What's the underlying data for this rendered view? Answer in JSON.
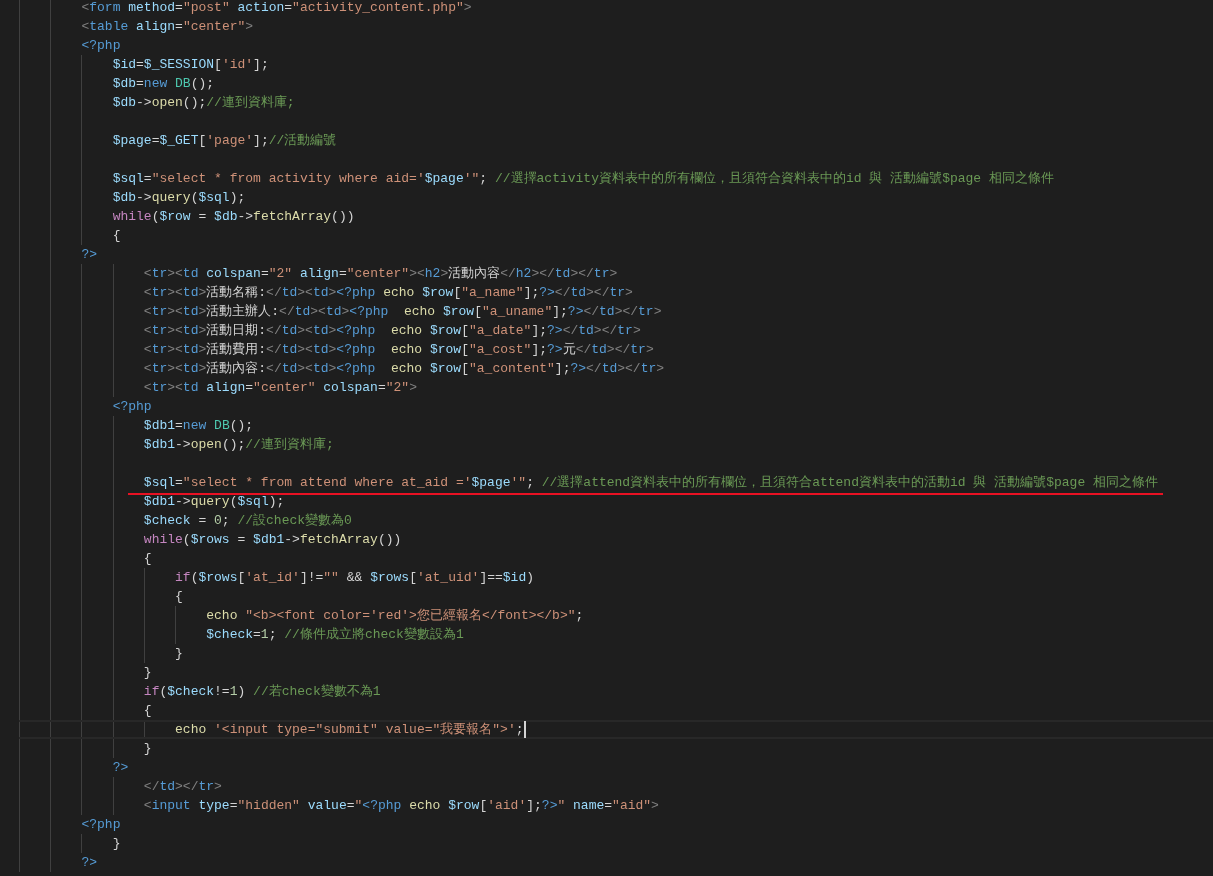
{
  "editor": {
    "lines": [
      {
        "kind": "code",
        "underlined": false,
        "current": false,
        "tokens": [
          {
            "kind": "bracket",
            "text": "        <"
          },
          {
            "kind": "tag",
            "text": "form"
          },
          {
            "kind": "attr",
            "text": " method"
          },
          {
            "kind": "plain",
            "text": "="
          },
          {
            "kind": "string",
            "text": "\"post\""
          },
          {
            "kind": "attr",
            "text": " action"
          },
          {
            "kind": "plain",
            "text": "="
          },
          {
            "kind": "string",
            "text": "\"activity_content.php\""
          },
          {
            "kind": "bracket",
            "text": ">"
          }
        ]
      },
      {
        "kind": "code",
        "underlined": false,
        "current": false,
        "tokens": [
          {
            "kind": "bracket",
            "text": "        <"
          },
          {
            "kind": "tag",
            "text": "table"
          },
          {
            "kind": "attr",
            "text": " align"
          },
          {
            "kind": "plain",
            "text": "="
          },
          {
            "kind": "string",
            "text": "\"center\""
          },
          {
            "kind": "bracket",
            "text": ">"
          }
        ]
      },
      {
        "kind": "code",
        "underlined": false,
        "current": false,
        "tokens": [
          {
            "kind": "tag",
            "text": "        <?php"
          }
        ]
      },
      {
        "kind": "code",
        "underlined": false,
        "current": false,
        "tokens": [
          {
            "kind": "var",
            "text": "            $id"
          },
          {
            "kind": "plain",
            "text": "="
          },
          {
            "kind": "var",
            "text": "$_SESSION"
          },
          {
            "kind": "plain",
            "text": "["
          },
          {
            "kind": "string",
            "text": "'id'"
          },
          {
            "kind": "plain",
            "text": "];"
          }
        ]
      },
      {
        "kind": "code",
        "underlined": false,
        "current": false,
        "tokens": [
          {
            "kind": "var",
            "text": "            $db"
          },
          {
            "kind": "plain",
            "text": "="
          },
          {
            "kind": "tag",
            "text": "new "
          },
          {
            "kind": "class",
            "text": "DB"
          },
          {
            "kind": "plain",
            "text": "();"
          }
        ]
      },
      {
        "kind": "code",
        "underlined": false,
        "current": false,
        "tokens": [
          {
            "kind": "var",
            "text": "            $db"
          },
          {
            "kind": "plain",
            "text": "->"
          },
          {
            "kind": "func",
            "text": "open"
          },
          {
            "kind": "plain",
            "text": "();"
          },
          {
            "kind": "comment",
            "text": "//連到資料庫;"
          }
        ]
      },
      {
        "kind": "blank"
      },
      {
        "kind": "code",
        "underlined": false,
        "current": false,
        "tokens": [
          {
            "kind": "var",
            "text": "            $page"
          },
          {
            "kind": "plain",
            "text": "="
          },
          {
            "kind": "var",
            "text": "$_GET"
          },
          {
            "kind": "plain",
            "text": "["
          },
          {
            "kind": "string",
            "text": "'page'"
          },
          {
            "kind": "plain",
            "text": "];"
          },
          {
            "kind": "comment",
            "text": "//活動編號"
          }
        ]
      },
      {
        "kind": "blank"
      },
      {
        "kind": "code",
        "underlined": false,
        "current": false,
        "tokens": [
          {
            "kind": "var",
            "text": "            $sql"
          },
          {
            "kind": "plain",
            "text": "="
          },
          {
            "kind": "string",
            "text": "\"select * from activity where aid='"
          },
          {
            "kind": "var",
            "text": "$page"
          },
          {
            "kind": "string",
            "text": "'\""
          },
          {
            "kind": "plain",
            "text": "; "
          },
          {
            "kind": "comment",
            "text": "//選擇activity資料表中的所有欄位，且須符合資料表中的id 與 活動編號$page 相同之條件"
          }
        ]
      },
      {
        "kind": "code",
        "underlined": false,
        "current": false,
        "tokens": [
          {
            "kind": "var",
            "text": "            $db"
          },
          {
            "kind": "plain",
            "text": "->"
          },
          {
            "kind": "func",
            "text": "query"
          },
          {
            "kind": "plain",
            "text": "("
          },
          {
            "kind": "var",
            "text": "$sql"
          },
          {
            "kind": "plain",
            "text": ");"
          }
        ]
      },
      {
        "kind": "code",
        "underlined": false,
        "current": false,
        "tokens": [
          {
            "kind": "keyword",
            "text": "            while"
          },
          {
            "kind": "plain",
            "text": "("
          },
          {
            "kind": "var",
            "text": "$row"
          },
          {
            "kind": "plain",
            "text": " = "
          },
          {
            "kind": "var",
            "text": "$db"
          },
          {
            "kind": "plain",
            "text": "->"
          },
          {
            "kind": "func",
            "text": "fetchArray"
          },
          {
            "kind": "plain",
            "text": "())"
          }
        ]
      },
      {
        "kind": "code",
        "underlined": false,
        "current": false,
        "tokens": [
          {
            "kind": "plain",
            "text": "            {"
          }
        ]
      },
      {
        "kind": "code",
        "underlined": false,
        "current": false,
        "tokens": [
          {
            "kind": "tag",
            "text": "        ?>"
          }
        ]
      },
      {
        "kind": "code",
        "underlined": false,
        "current": false,
        "tokens": [
          {
            "kind": "bracket",
            "text": "                <"
          },
          {
            "kind": "tag",
            "text": "tr"
          },
          {
            "kind": "bracket",
            "text": "><"
          },
          {
            "kind": "tag",
            "text": "td"
          },
          {
            "kind": "attr",
            "text": " colspan"
          },
          {
            "kind": "plain",
            "text": "="
          },
          {
            "kind": "string",
            "text": "\"2\""
          },
          {
            "kind": "attr",
            "text": " align"
          },
          {
            "kind": "plain",
            "text": "="
          },
          {
            "kind": "string",
            "text": "\"center\""
          },
          {
            "kind": "bracket",
            "text": "><"
          },
          {
            "kind": "tag",
            "text": "h2"
          },
          {
            "kind": "bracket",
            "text": ">"
          },
          {
            "kind": "plain",
            "text": "活動內容"
          },
          {
            "kind": "bracket",
            "text": "</"
          },
          {
            "kind": "tag",
            "text": "h2"
          },
          {
            "kind": "bracket",
            "text": "></"
          },
          {
            "kind": "tag",
            "text": "td"
          },
          {
            "kind": "bracket",
            "text": "></"
          },
          {
            "kind": "tag",
            "text": "tr"
          },
          {
            "kind": "bracket",
            "text": ">"
          }
        ]
      },
      {
        "kind": "code",
        "underlined": false,
        "current": false,
        "tokens": [
          {
            "kind": "bracket",
            "text": "                <"
          },
          {
            "kind": "tag",
            "text": "tr"
          },
          {
            "kind": "bracket",
            "text": "><"
          },
          {
            "kind": "tag",
            "text": "td"
          },
          {
            "kind": "bracket",
            "text": ">"
          },
          {
            "kind": "plain",
            "text": "活動名稱:"
          },
          {
            "kind": "bracket",
            "text": "</"
          },
          {
            "kind": "tag",
            "text": "td"
          },
          {
            "kind": "bracket",
            "text": "><"
          },
          {
            "kind": "tag",
            "text": "td"
          },
          {
            "kind": "bracket",
            "text": ">"
          },
          {
            "kind": "tag",
            "text": "<?php"
          },
          {
            "kind": "func",
            "text": " echo "
          },
          {
            "kind": "var",
            "text": "$row"
          },
          {
            "kind": "plain",
            "text": "["
          },
          {
            "kind": "string",
            "text": "\"a_name\""
          },
          {
            "kind": "plain",
            "text": "];"
          },
          {
            "kind": "tag",
            "text": "?>"
          },
          {
            "kind": "bracket",
            "text": "</"
          },
          {
            "kind": "tag",
            "text": "td"
          },
          {
            "kind": "bracket",
            "text": "></"
          },
          {
            "kind": "tag",
            "text": "tr"
          },
          {
            "kind": "bracket",
            "text": ">"
          }
        ]
      },
      {
        "kind": "code",
        "underlined": false,
        "current": false,
        "tokens": [
          {
            "kind": "bracket",
            "text": "                <"
          },
          {
            "kind": "tag",
            "text": "tr"
          },
          {
            "kind": "bracket",
            "text": "><"
          },
          {
            "kind": "tag",
            "text": "td"
          },
          {
            "kind": "bracket",
            "text": ">"
          },
          {
            "kind": "plain",
            "text": "活動主辦人:"
          },
          {
            "kind": "bracket",
            "text": "</"
          },
          {
            "kind": "tag",
            "text": "td"
          },
          {
            "kind": "bracket",
            "text": "><"
          },
          {
            "kind": "tag",
            "text": "td"
          },
          {
            "kind": "bracket",
            "text": ">"
          },
          {
            "kind": "tag",
            "text": "<?php"
          },
          {
            "kind": "func",
            "text": "  echo "
          },
          {
            "kind": "var",
            "text": "$row"
          },
          {
            "kind": "plain",
            "text": "["
          },
          {
            "kind": "string",
            "text": "\"a_uname\""
          },
          {
            "kind": "plain",
            "text": "];"
          },
          {
            "kind": "tag",
            "text": "?>"
          },
          {
            "kind": "bracket",
            "text": "</"
          },
          {
            "kind": "tag",
            "text": "td"
          },
          {
            "kind": "bracket",
            "text": "></"
          },
          {
            "kind": "tag",
            "text": "tr"
          },
          {
            "kind": "bracket",
            "text": ">"
          }
        ]
      },
      {
        "kind": "code",
        "underlined": false,
        "current": false,
        "tokens": [
          {
            "kind": "bracket",
            "text": "                <"
          },
          {
            "kind": "tag",
            "text": "tr"
          },
          {
            "kind": "bracket",
            "text": "><"
          },
          {
            "kind": "tag",
            "text": "td"
          },
          {
            "kind": "bracket",
            "text": ">"
          },
          {
            "kind": "plain",
            "text": "活動日期:"
          },
          {
            "kind": "bracket",
            "text": "</"
          },
          {
            "kind": "tag",
            "text": "td"
          },
          {
            "kind": "bracket",
            "text": "><"
          },
          {
            "kind": "tag",
            "text": "td"
          },
          {
            "kind": "bracket",
            "text": ">"
          },
          {
            "kind": "tag",
            "text": "<?php"
          },
          {
            "kind": "func",
            "text": "  echo "
          },
          {
            "kind": "var",
            "text": "$row"
          },
          {
            "kind": "plain",
            "text": "["
          },
          {
            "kind": "string",
            "text": "\"a_date\""
          },
          {
            "kind": "plain",
            "text": "];"
          },
          {
            "kind": "tag",
            "text": "?>"
          },
          {
            "kind": "bracket",
            "text": "</"
          },
          {
            "kind": "tag",
            "text": "td"
          },
          {
            "kind": "bracket",
            "text": "></"
          },
          {
            "kind": "tag",
            "text": "tr"
          },
          {
            "kind": "bracket",
            "text": ">"
          }
        ]
      },
      {
        "kind": "code",
        "underlined": false,
        "current": false,
        "tokens": [
          {
            "kind": "bracket",
            "text": "                <"
          },
          {
            "kind": "tag",
            "text": "tr"
          },
          {
            "kind": "bracket",
            "text": "><"
          },
          {
            "kind": "tag",
            "text": "td"
          },
          {
            "kind": "bracket",
            "text": ">"
          },
          {
            "kind": "plain",
            "text": "活動費用:"
          },
          {
            "kind": "bracket",
            "text": "</"
          },
          {
            "kind": "tag",
            "text": "td"
          },
          {
            "kind": "bracket",
            "text": "><"
          },
          {
            "kind": "tag",
            "text": "td"
          },
          {
            "kind": "bracket",
            "text": ">"
          },
          {
            "kind": "tag",
            "text": "<?php"
          },
          {
            "kind": "func",
            "text": "  echo "
          },
          {
            "kind": "var",
            "text": "$row"
          },
          {
            "kind": "plain",
            "text": "["
          },
          {
            "kind": "string",
            "text": "\"a_cost\""
          },
          {
            "kind": "plain",
            "text": "];"
          },
          {
            "kind": "tag",
            "text": "?>"
          },
          {
            "kind": "plain",
            "text": "元"
          },
          {
            "kind": "bracket",
            "text": "</"
          },
          {
            "kind": "tag",
            "text": "td"
          },
          {
            "kind": "bracket",
            "text": "></"
          },
          {
            "kind": "tag",
            "text": "tr"
          },
          {
            "kind": "bracket",
            "text": ">"
          }
        ]
      },
      {
        "kind": "code",
        "underlined": false,
        "current": false,
        "tokens": [
          {
            "kind": "bracket",
            "text": "                <"
          },
          {
            "kind": "tag",
            "text": "tr"
          },
          {
            "kind": "bracket",
            "text": "><"
          },
          {
            "kind": "tag",
            "text": "td"
          },
          {
            "kind": "bracket",
            "text": ">"
          },
          {
            "kind": "plain",
            "text": "活動內容:"
          },
          {
            "kind": "bracket",
            "text": "</"
          },
          {
            "kind": "tag",
            "text": "td"
          },
          {
            "kind": "bracket",
            "text": "><"
          },
          {
            "kind": "tag",
            "text": "td"
          },
          {
            "kind": "bracket",
            "text": ">"
          },
          {
            "kind": "tag",
            "text": "<?php"
          },
          {
            "kind": "func",
            "text": "  echo "
          },
          {
            "kind": "var",
            "text": "$row"
          },
          {
            "kind": "plain",
            "text": "["
          },
          {
            "kind": "string",
            "text": "\"a_content\""
          },
          {
            "kind": "plain",
            "text": "];"
          },
          {
            "kind": "tag",
            "text": "?>"
          },
          {
            "kind": "bracket",
            "text": "</"
          },
          {
            "kind": "tag",
            "text": "td"
          },
          {
            "kind": "bracket",
            "text": "></"
          },
          {
            "kind": "tag",
            "text": "tr"
          },
          {
            "kind": "bracket",
            "text": ">"
          }
        ]
      },
      {
        "kind": "code",
        "underlined": false,
        "current": false,
        "tokens": [
          {
            "kind": "bracket",
            "text": "                <"
          },
          {
            "kind": "tag",
            "text": "tr"
          },
          {
            "kind": "bracket",
            "text": "><"
          },
          {
            "kind": "tag",
            "text": "td"
          },
          {
            "kind": "attr",
            "text": " align"
          },
          {
            "kind": "plain",
            "text": "="
          },
          {
            "kind": "string",
            "text": "\"center\""
          },
          {
            "kind": "attr",
            "text": " colspan"
          },
          {
            "kind": "plain",
            "text": "="
          },
          {
            "kind": "string",
            "text": "\"2\""
          },
          {
            "kind": "bracket",
            "text": ">"
          }
        ]
      },
      {
        "kind": "code",
        "underlined": false,
        "current": false,
        "tokens": [
          {
            "kind": "tag",
            "text": "            <?php"
          }
        ]
      },
      {
        "kind": "code",
        "underlined": false,
        "current": false,
        "tokens": [
          {
            "kind": "var",
            "text": "                $db1"
          },
          {
            "kind": "plain",
            "text": "="
          },
          {
            "kind": "tag",
            "text": "new "
          },
          {
            "kind": "class",
            "text": "DB"
          },
          {
            "kind": "plain",
            "text": "();"
          }
        ]
      },
      {
        "kind": "code",
        "underlined": false,
        "current": false,
        "tokens": [
          {
            "kind": "var",
            "text": "                $db1"
          },
          {
            "kind": "plain",
            "text": "->"
          },
          {
            "kind": "func",
            "text": "open"
          },
          {
            "kind": "plain",
            "text": "();"
          },
          {
            "kind": "comment",
            "text": "//連到資料庫;"
          }
        ]
      },
      {
        "kind": "blank"
      },
      {
        "kind": "code",
        "underlined": true,
        "current": false,
        "tokens": [
          {
            "kind": "var",
            "text": "                $sql"
          },
          {
            "kind": "plain",
            "text": "="
          },
          {
            "kind": "string",
            "text": "\"select * from attend where at_aid ='"
          },
          {
            "kind": "var",
            "text": "$page"
          },
          {
            "kind": "string",
            "text": "'\""
          },
          {
            "kind": "plain",
            "text": "; "
          },
          {
            "kind": "comment",
            "text": "//選擇attend資料表中的所有欄位，且須符合attend資料表中的活動id 與 活動編號$page 相同之條件"
          }
        ]
      },
      {
        "kind": "code",
        "underlined": false,
        "current": false,
        "tokens": [
          {
            "kind": "var",
            "text": "                $db1"
          },
          {
            "kind": "plain",
            "text": "->"
          },
          {
            "kind": "func",
            "text": "query"
          },
          {
            "kind": "plain",
            "text": "("
          },
          {
            "kind": "var",
            "text": "$sql"
          },
          {
            "kind": "plain",
            "text": ");"
          }
        ]
      },
      {
        "kind": "code",
        "underlined": false,
        "current": false,
        "tokens": [
          {
            "kind": "var",
            "text": "                $check"
          },
          {
            "kind": "plain",
            "text": " = "
          },
          {
            "kind": "number",
            "text": "0"
          },
          {
            "kind": "plain",
            "text": "; "
          },
          {
            "kind": "comment",
            "text": "//設check變數為0"
          }
        ]
      },
      {
        "kind": "code",
        "underlined": false,
        "current": false,
        "tokens": [
          {
            "kind": "keyword",
            "text": "                while"
          },
          {
            "kind": "plain",
            "text": "("
          },
          {
            "kind": "var",
            "text": "$rows"
          },
          {
            "kind": "plain",
            "text": " = "
          },
          {
            "kind": "var",
            "text": "$db1"
          },
          {
            "kind": "plain",
            "text": "->"
          },
          {
            "kind": "func",
            "text": "fetchArray"
          },
          {
            "kind": "plain",
            "text": "())"
          }
        ]
      },
      {
        "kind": "code",
        "underlined": false,
        "current": false,
        "tokens": [
          {
            "kind": "plain",
            "text": "                {"
          }
        ]
      },
      {
        "kind": "code",
        "underlined": false,
        "current": false,
        "tokens": [
          {
            "kind": "keyword",
            "text": "                    if"
          },
          {
            "kind": "plain",
            "text": "("
          },
          {
            "kind": "var",
            "text": "$rows"
          },
          {
            "kind": "plain",
            "text": "["
          },
          {
            "kind": "string",
            "text": "'at_id'"
          },
          {
            "kind": "plain",
            "text": "]!="
          },
          {
            "kind": "string",
            "text": "\"\""
          },
          {
            "kind": "plain",
            "text": " && "
          },
          {
            "kind": "var",
            "text": "$rows"
          },
          {
            "kind": "plain",
            "text": "["
          },
          {
            "kind": "string",
            "text": "'at_uid'"
          },
          {
            "kind": "plain",
            "text": "]=="
          },
          {
            "kind": "var",
            "text": "$id"
          },
          {
            "kind": "plain",
            "text": ")"
          }
        ]
      },
      {
        "kind": "code",
        "underlined": false,
        "current": false,
        "tokens": [
          {
            "kind": "plain",
            "text": "                    {"
          }
        ]
      },
      {
        "kind": "code",
        "underlined": false,
        "current": false,
        "tokens": [
          {
            "kind": "func",
            "text": "                        echo "
          },
          {
            "kind": "string",
            "text": "\"<b><font color='red'>您已經報名</font></b>\""
          },
          {
            "kind": "plain",
            "text": ";"
          }
        ]
      },
      {
        "kind": "code",
        "underlined": false,
        "current": false,
        "tokens": [
          {
            "kind": "var",
            "text": "                        $check"
          },
          {
            "kind": "plain",
            "text": "="
          },
          {
            "kind": "number",
            "text": "1"
          },
          {
            "kind": "plain",
            "text": "; "
          },
          {
            "kind": "comment",
            "text": "//條件成立將check變數設為1"
          }
        ]
      },
      {
        "kind": "code",
        "underlined": false,
        "current": false,
        "tokens": [
          {
            "kind": "plain",
            "text": "                    }"
          }
        ]
      },
      {
        "kind": "code",
        "underlined": false,
        "current": false,
        "tokens": [
          {
            "kind": "plain",
            "text": "                }"
          }
        ]
      },
      {
        "kind": "code",
        "underlined": false,
        "current": false,
        "tokens": [
          {
            "kind": "keyword",
            "text": "                if"
          },
          {
            "kind": "plain",
            "text": "("
          },
          {
            "kind": "var",
            "text": "$check"
          },
          {
            "kind": "plain",
            "text": "!="
          },
          {
            "kind": "number",
            "text": "1"
          },
          {
            "kind": "plain",
            "text": ") "
          },
          {
            "kind": "comment",
            "text": "//若check變數不為1"
          }
        ]
      },
      {
        "kind": "code",
        "underlined": false,
        "current": false,
        "tokens": [
          {
            "kind": "plain",
            "text": "                {"
          }
        ]
      },
      {
        "kind": "code",
        "underlined": false,
        "current": true,
        "tokens": [
          {
            "kind": "func",
            "text": "                    echo "
          },
          {
            "kind": "string",
            "text": "'<input type=\"submit\" value=\"我要報名\">'"
          },
          {
            "kind": "plain",
            "text": ";"
          }
        ]
      },
      {
        "kind": "code",
        "underlined": false,
        "current": false,
        "tokens": [
          {
            "kind": "plain",
            "text": "                }"
          }
        ]
      },
      {
        "kind": "code",
        "underlined": false,
        "current": false,
        "tokens": [
          {
            "kind": "tag",
            "text": "            ?>"
          }
        ]
      },
      {
        "kind": "code",
        "underlined": false,
        "current": false,
        "tokens": [
          {
            "kind": "bracket",
            "text": "                </"
          },
          {
            "kind": "tag",
            "text": "td"
          },
          {
            "kind": "bracket",
            "text": "></"
          },
          {
            "kind": "tag",
            "text": "tr"
          },
          {
            "kind": "bracket",
            "text": ">"
          }
        ]
      },
      {
        "kind": "code",
        "underlined": false,
        "current": false,
        "tokens": [
          {
            "kind": "bracket",
            "text": "                <"
          },
          {
            "kind": "tag",
            "text": "input"
          },
          {
            "kind": "attr",
            "text": " type"
          },
          {
            "kind": "plain",
            "text": "="
          },
          {
            "kind": "string",
            "text": "\"hidden\""
          },
          {
            "kind": "attr",
            "text": " value"
          },
          {
            "kind": "plain",
            "text": "="
          },
          {
            "kind": "string",
            "text": "\""
          },
          {
            "kind": "tag",
            "text": "<?php"
          },
          {
            "kind": "func",
            "text": " echo "
          },
          {
            "kind": "var",
            "text": "$row"
          },
          {
            "kind": "plain",
            "text": "["
          },
          {
            "kind": "string",
            "text": "'aid'"
          },
          {
            "kind": "plain",
            "text": "];"
          },
          {
            "kind": "tag",
            "text": "?>"
          },
          {
            "kind": "string",
            "text": "\""
          },
          {
            "kind": "attr",
            "text": " name"
          },
          {
            "kind": "plain",
            "text": "="
          },
          {
            "kind": "string",
            "text": "\"aid\""
          },
          {
            "kind": "bracket",
            "text": ">"
          }
        ]
      },
      {
        "kind": "code",
        "underlined": false,
        "current": false,
        "tokens": [
          {
            "kind": "tag",
            "text": "        <?php"
          }
        ]
      },
      {
        "kind": "code",
        "underlined": false,
        "current": false,
        "tokens": [
          {
            "kind": "plain",
            "text": "            }"
          }
        ]
      },
      {
        "kind": "code",
        "underlined": false,
        "current": false,
        "tokens": [
          {
            "kind": "tag",
            "text": "        ?>"
          }
        ]
      }
    ]
  }
}
